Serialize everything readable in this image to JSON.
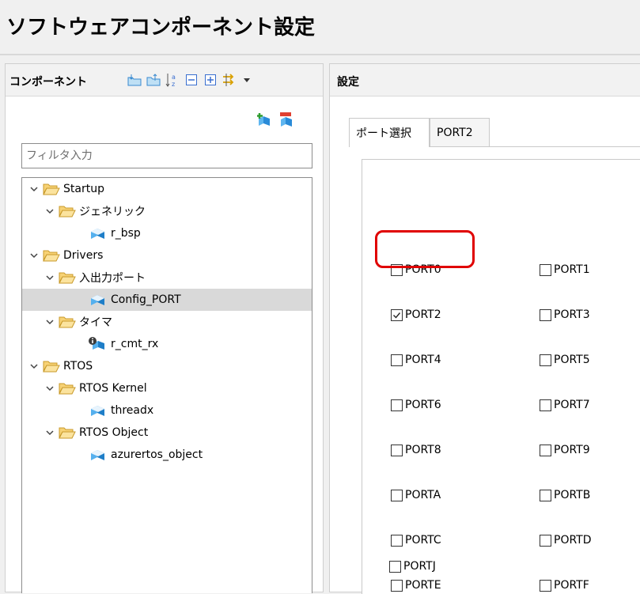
{
  "header": {
    "title": "ソフトウェアコンポーネント設定"
  },
  "left_panel": {
    "title": "コンポーネント",
    "toolbar_icons": [
      "collapse-folder-icon",
      "expand-folder-icon",
      "sort-alpha-icon",
      "collapse-all-icon",
      "expand-all-icon",
      "link-arrows-icon",
      "dropdown-icon"
    ],
    "add_icons": [
      "add-component-icon",
      "remove-component-icon"
    ],
    "filter": {
      "placeholder": "フィルタ入力",
      "value": ""
    },
    "tree": [
      {
        "label": "Startup"
      },
      {
        "label": "ジェネリック"
      },
      {
        "label": "r_bsp"
      },
      {
        "label": "Drivers"
      },
      {
        "label": "入出力ポート"
      },
      {
        "label": "Config_PORT"
      },
      {
        "label": "タイマ"
      },
      {
        "label": "r_cmt_rx"
      },
      {
        "label": "RTOS"
      },
      {
        "label": "RTOS Kernel"
      },
      {
        "label": "threadx"
      },
      {
        "label": "RTOS Object"
      },
      {
        "label": "azurertos_object"
      }
    ]
  },
  "right_panel": {
    "title": "設定",
    "tabs": [
      {
        "label": "ポート選択",
        "active": true
      },
      {
        "label": "PORT2",
        "active": false
      }
    ],
    "ports": [
      {
        "label": "PORT0",
        "checked": false
      },
      {
        "label": "PORT1",
        "checked": false
      },
      {
        "label": "PORT2",
        "checked": true
      },
      {
        "label": "PORT3",
        "checked": false
      },
      {
        "label": "PORT4",
        "checked": false
      },
      {
        "label": "PORT5",
        "checked": false
      },
      {
        "label": "PORT6",
        "checked": false
      },
      {
        "label": "PORT7",
        "checked": false
      },
      {
        "label": "PORT8",
        "checked": false
      },
      {
        "label": "PORT9",
        "checked": false
      },
      {
        "label": "PORTA",
        "checked": false
      },
      {
        "label": "PORTB",
        "checked": false
      },
      {
        "label": "PORTC",
        "checked": false
      },
      {
        "label": "PORTD",
        "checked": false
      },
      {
        "label": "PORTE",
        "checked": false
      },
      {
        "label": "PORTF",
        "checked": false
      },
      {
        "label": "PORTJ",
        "checked": false
      }
    ]
  },
  "colors": {
    "highlight": "#e00000",
    "selected_row": "#d9d9d9",
    "folder": "#f3c24f",
    "cube": "#1e90d8"
  }
}
